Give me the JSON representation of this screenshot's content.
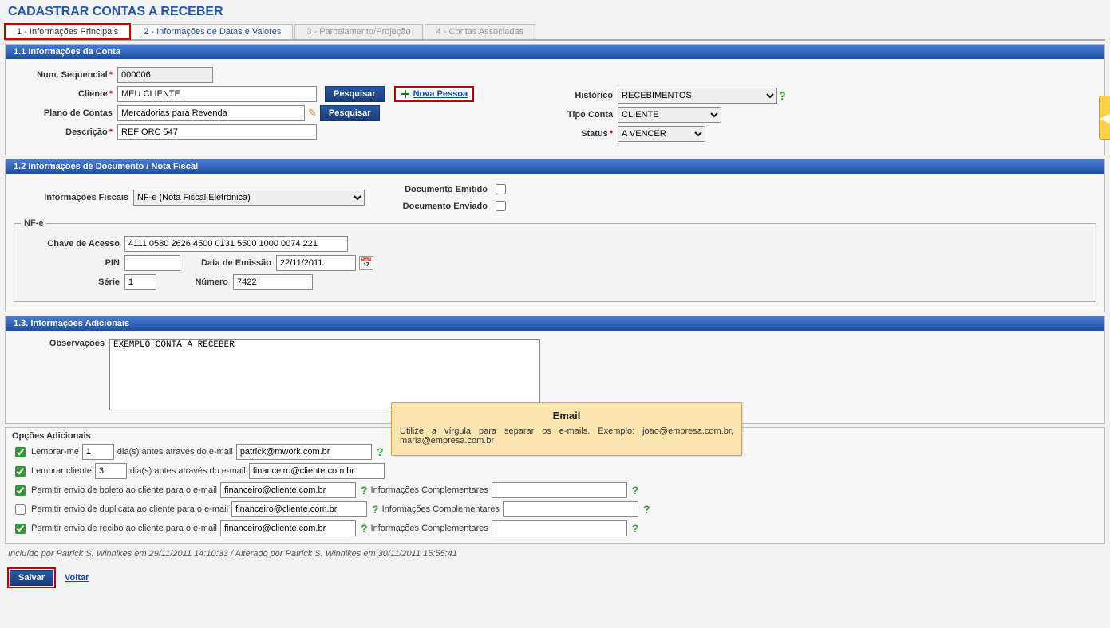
{
  "page": {
    "title": "CADASTRAR CONTAS A RECEBER"
  },
  "tabs": {
    "t1": "1 - Informações Principais",
    "t2": "2 - Informações de Datas e Valores",
    "t3": "3 - Parcelamento/Projeção",
    "t4": "4 - Contas Associadas"
  },
  "s11": {
    "head": "1.1 Informações da Conta",
    "numSeq_lbl": "Num. Sequencial",
    "numSeq_val": "000006",
    "cliente_lbl": "Cliente",
    "cliente_val": "MEU CLIENTE",
    "pesquisar_btn": "Pesquisar",
    "nova_pessoa": "Nova Pessoa",
    "plano_lbl": "Plano de Contas",
    "plano_val": "Mercadorias para Revenda",
    "desc_lbl": "Descrição",
    "desc_val": "REF ORC 547",
    "hist_lbl": "Histórico",
    "hist_val": "RECEBIMENTOS",
    "tipo_lbl": "Tipo Conta",
    "tipo_val": "CLIENTE",
    "status_lbl": "Status",
    "status_val": "A VENCER"
  },
  "s12": {
    "head": "1.2 Informações de Documento / Nota Fiscal",
    "info_fiscal_lbl": "Informações Fiscais",
    "info_fiscal_val": "NF-e (Nota Fiscal Eletrônica)",
    "doc_emit_lbl": "Documento Emitido",
    "doc_env_lbl": "Documento Enviado",
    "nfe_legend": "NF-e",
    "chave_lbl": "Chave de Acesso",
    "chave_val": "4111 0580 2626 4500 0131 5500 1000 0074 221",
    "pin_lbl": "PIN",
    "pin_val": "",
    "data_lbl": "Data de Emissão",
    "data_val": "22/11/2011",
    "serie_lbl": "Série",
    "serie_val": "1",
    "num_lbl": "Número",
    "num_val": "7422"
  },
  "s13": {
    "head": "1.3. Informações Adicionais",
    "obs_lbl": "Observações",
    "obs_val": "EXEMPLO CONTA A RECEBER"
  },
  "opts": {
    "head": "Opções Adicionais",
    "r1a": "Lembrar-me",
    "r1_days": "1",
    "r1b": "dia(s) antes através do e-mail",
    "r1_email": "patrick@mwork.com.br",
    "r2a": "Lembrar cliente",
    "r2_days": "3",
    "r2b": "dia(s) antes através do e-mail",
    "r2_email": "financeiro@cliente.com.br",
    "r3a": "Permitir envio de boleto ao cliente para o e-mail",
    "r3_email": "financeiro@cliente.com.br",
    "r4a": "Permitir envio de duplicata ao cliente para o e-mail",
    "r4_email": "financeiro@cliente.com.br",
    "r5a": "Permitir envio de recibo ao cliente para o e-mail",
    "r5_email": "financeiro@cliente.com.br",
    "info_comp_lbl": "Informações Complementares"
  },
  "audit": "Incluído por Patrick S. Winnikes em 29/11/2011 14:10:33 / Alterado por Patrick S. Winnikes em 30/11/2011 15:55:41",
  "actions": {
    "salvar": "Salvar",
    "voltar": "Voltar"
  },
  "tooltip": {
    "title": "Email",
    "body": "Utilize a vírgula para separar os e-mails. Exemplo: joao@empresa.com.br, maria@empresa.com.br"
  }
}
